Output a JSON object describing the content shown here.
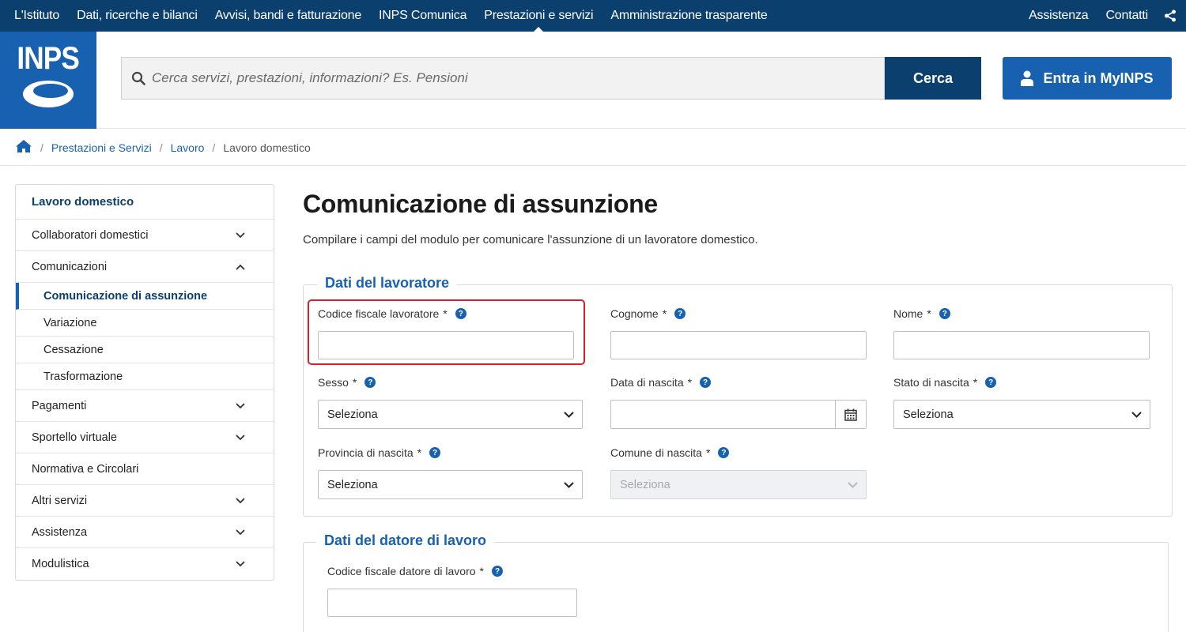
{
  "topnav": {
    "items": [
      "L'Istituto",
      "Dati, ricerche e bilanci",
      "Avvisi, bandi e fatturazione",
      "INPS Comunica",
      "Prestazioni e servizi",
      "Amministrazione trasparente"
    ],
    "right_items": [
      "Assistenza",
      "Contatti"
    ],
    "share_icon": "share-icon"
  },
  "header": {
    "logo_text": "INPS",
    "search": {
      "placeholder": "Cerca servizi, prestazioni, informazioni? Es. Pensioni",
      "icon": "search-icon"
    },
    "search_button": "Cerca",
    "login_button": "Entra in MyINPS",
    "login_icon": "user-icon"
  },
  "breadcrumb": {
    "home_icon": "home-icon",
    "items": [
      "Prestazioni e Servizi",
      "Lavoro",
      "Lavoro domestico"
    ]
  },
  "sidebar": {
    "title": "Lavoro domestico",
    "items": [
      {
        "label": "Collaboratori domestici",
        "icon": "chevron-down-icon"
      },
      {
        "label": "Comunicazioni",
        "icon": "chevron-up-icon"
      },
      {
        "label": "Comunicazione di assunzione"
      },
      {
        "label": "Variazione"
      },
      {
        "label": "Cessazione"
      },
      {
        "label": "Trasformazione"
      },
      {
        "label": "Pagamenti",
        "icon": "chevron-down-icon"
      },
      {
        "label": "Sportello virtuale",
        "icon": "chevron-down-icon"
      },
      {
        "label": "Normativa e Circolari"
      },
      {
        "label": "Altri servizi",
        "icon": "chevron-down-icon"
      },
      {
        "label": "Assistenza",
        "icon": "chevron-down-icon"
      },
      {
        "label": "Modulistica",
        "icon": "chevron-down-icon"
      }
    ]
  },
  "main": {
    "title": "Comunicazione di assunzione",
    "intro": "Compilare i campi del modulo per comunicare l'assunzione di un lavoratore domestico.",
    "worker": {
      "legend": "Dati del lavoratore",
      "required_mark": "*",
      "help_glyph": "?",
      "fields": {
        "codice_fiscale": "Codice fiscale lavoratore",
        "cognome": "Cognome",
        "nome": "Nome",
        "sesso": "Sesso",
        "data_nascita": "Data di nascita",
        "stato_nascita": "Stato di nascita",
        "provincia_nascita": "Provincia di nascita",
        "comune_nascita": "Comune di nascita"
      },
      "select_placeholder": "Seleziona"
    },
    "employer": {
      "legend": "Dati del datore di lavoro",
      "fields": {
        "codice_fiscale": "Codice fiscale datore di lavoro"
      }
    }
  },
  "colors": {
    "nav_bg": "#0b3f6e",
    "brand_blue": "#1761b0",
    "highlight": "#d2232a"
  }
}
